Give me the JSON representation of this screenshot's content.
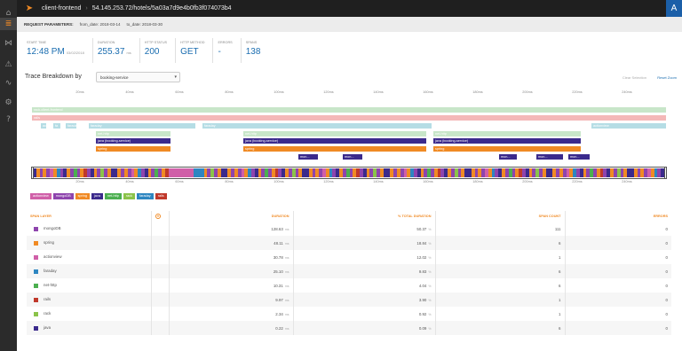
{
  "sidebar": {
    "icons": [
      {
        "name": "home-icon",
        "glyph": "⌂"
      },
      {
        "name": "traces-icon",
        "glyph": "≣"
      },
      {
        "name": "map-icon",
        "glyph": "⋈"
      },
      {
        "name": "alerts-icon",
        "glyph": "⚠"
      },
      {
        "name": "metrics-icon",
        "glyph": "∿"
      },
      {
        "name": "settings-icon",
        "glyph": "⚙"
      },
      {
        "name": "help-icon",
        "glyph": "?"
      }
    ]
  },
  "header": {
    "app": "client-frontend",
    "path": "54.145.253.72/hotels/5a03a7d9e4b0fb3f074073b4",
    "avatar": "A"
  },
  "params": {
    "label": "REQUEST PARAMETERS:",
    "from_key": "from_date:",
    "from_val": "2018-03-14",
    "to_key": "to_date:",
    "to_val": "2018-03-30"
  },
  "stats": [
    {
      "label": "START TIME",
      "value": "12:48 PM",
      "sub": "03/02/2018"
    },
    {
      "label": "DURATION",
      "value": "255.37",
      "sub": "ms"
    },
    {
      "label": "HTTP STATUS",
      "value": "200",
      "sub": ""
    },
    {
      "label": "HTTP METHOD",
      "value": "GET",
      "sub": ""
    },
    {
      "label": "ERRORS",
      "value": "-",
      "sub": ""
    },
    {
      "label": "SPANS",
      "value": "138",
      "sub": ""
    }
  ],
  "breakdown": {
    "title": "Trace Breakdown by",
    "select_value": "booking-service",
    "clear": "Clear Selection",
    "reset": "Reset Zoom"
  },
  "timeline": {
    "ticks_top": [
      "20ms",
      "40ms",
      "60ms",
      "80ms",
      "100ms",
      "120ms",
      "140ms",
      "160ms",
      "180ms",
      "200ms",
      "220ms",
      "240ms"
    ],
    "ticks_bottom": [
      "20ms",
      "40ms",
      "60ms",
      "80ms",
      "100ms",
      "120ms",
      "140ms",
      "160ms",
      "180ms",
      "200ms",
      "220ms",
      "240ms"
    ],
    "bars": [
      {
        "label": "rack-client-frontend",
        "color": "#c8e6c9",
        "text": "#fff"
      },
      {
        "label": "rails",
        "color": "#f4b8b8",
        "text": "#fff"
      },
      {
        "label": "ac",
        "color": "#b5dde5",
        "text": "#fff"
      },
      {
        "label": "fa",
        "color": "#b5dde5",
        "text": "#fff"
      },
      {
        "label": "faraday",
        "color": "#b5dde5",
        "text": "#fff"
      },
      {
        "label": "faraday",
        "color": "#b5dde5",
        "text": "#fff"
      },
      {
        "label": "faraday",
        "color": "#b5dde5",
        "text": "#fff"
      },
      {
        "label": "actionview",
        "color": "#b5dde5",
        "text": "#fff"
      },
      {
        "label": "net-http",
        "color": "#c8e6c9",
        "text": "#fff"
      },
      {
        "label": "net-http",
        "color": "#c8e6c9",
        "text": "#fff"
      },
      {
        "label": "net-http",
        "color": "#c8e6c9",
        "text": "#fff"
      },
      {
        "label": "java (booking-service)",
        "color": "#3b2a8c",
        "text": "#fff"
      },
      {
        "label": "java (booking-service)",
        "color": "#3b2a8c",
        "text": "#fff"
      },
      {
        "label": "java (booking-service)",
        "color": "#3b2a8c",
        "text": "#fff"
      },
      {
        "label": "spring",
        "color": "#f08a24",
        "text": "#fff"
      },
      {
        "label": "spring",
        "color": "#f08a24",
        "text": "#fff"
      },
      {
        "label": "spring",
        "color": "#f08a24",
        "text": "#fff"
      },
      {
        "label": "mon...",
        "color": "#3b2a8c",
        "text": "#fff"
      },
      {
        "label": "mon...",
        "color": "#3b2a8c",
        "text": "#fff"
      },
      {
        "label": "mon...",
        "color": "#3b2a8c",
        "text": "#fff"
      },
      {
        "label": "mon...",
        "color": "#3b2a8c",
        "text": "#fff"
      },
      {
        "label": "mon...",
        "color": "#3b2a8c",
        "text": "#fff"
      }
    ]
  },
  "legend": [
    {
      "label": "actionview",
      "color": "#d05fa8"
    },
    {
      "label": "mongoDB",
      "color": "#8e44ad"
    },
    {
      "label": "spring",
      "color": "#f08a24"
    },
    {
      "label": "java",
      "color": "#3b2a8c"
    },
    {
      "label": "net-http",
      "color": "#4caf50"
    },
    {
      "label": "rack",
      "color": "#8bc34a"
    },
    {
      "label": "faraday",
      "color": "#2e86c1"
    },
    {
      "label": "rails",
      "color": "#c0392b"
    }
  ],
  "table": {
    "headers": [
      "SPAN LAYER",
      "",
      "DURATION",
      "% TOTAL DURATION",
      "SPAN COUNT",
      "ERRORS"
    ],
    "rows": [
      {
        "layer": "mongoDB",
        "color": "#8e44ad",
        "duration": "128.63",
        "unit": "ms",
        "pct": "50.37",
        "count": "111",
        "errors": "0"
      },
      {
        "layer": "spring",
        "color": "#f08a24",
        "duration": "48.11",
        "unit": "ms",
        "pct": "18.84",
        "count": "6",
        "errors": "0"
      },
      {
        "layer": "actionview",
        "color": "#d05fa8",
        "duration": "30.78",
        "unit": "ms",
        "pct": "12.02",
        "count": "1",
        "errors": "0"
      },
      {
        "layer": "faraday",
        "color": "#2e86c1",
        "duration": "25.10",
        "unit": "ms",
        "pct": "9.83",
        "count": "6",
        "errors": "0"
      },
      {
        "layer": "net-http",
        "color": "#4caf50",
        "duration": "10.31",
        "unit": "ms",
        "pct": "4.04",
        "count": "6",
        "errors": "0"
      },
      {
        "layer": "rails",
        "color": "#c0392b",
        "duration": "9.97",
        "unit": "ms",
        "pct": "3.90",
        "count": "1",
        "errors": "0"
      },
      {
        "layer": "rack",
        "color": "#8bc34a",
        "duration": "2.34",
        "unit": "ms",
        "pct": "0.92",
        "count": "1",
        "errors": "0"
      },
      {
        "layer": "java",
        "color": "#3b2a8c",
        "duration": "0.22",
        "unit": "ms",
        "pct": "0.09",
        "count": "6",
        "errors": "0"
      }
    ]
  }
}
